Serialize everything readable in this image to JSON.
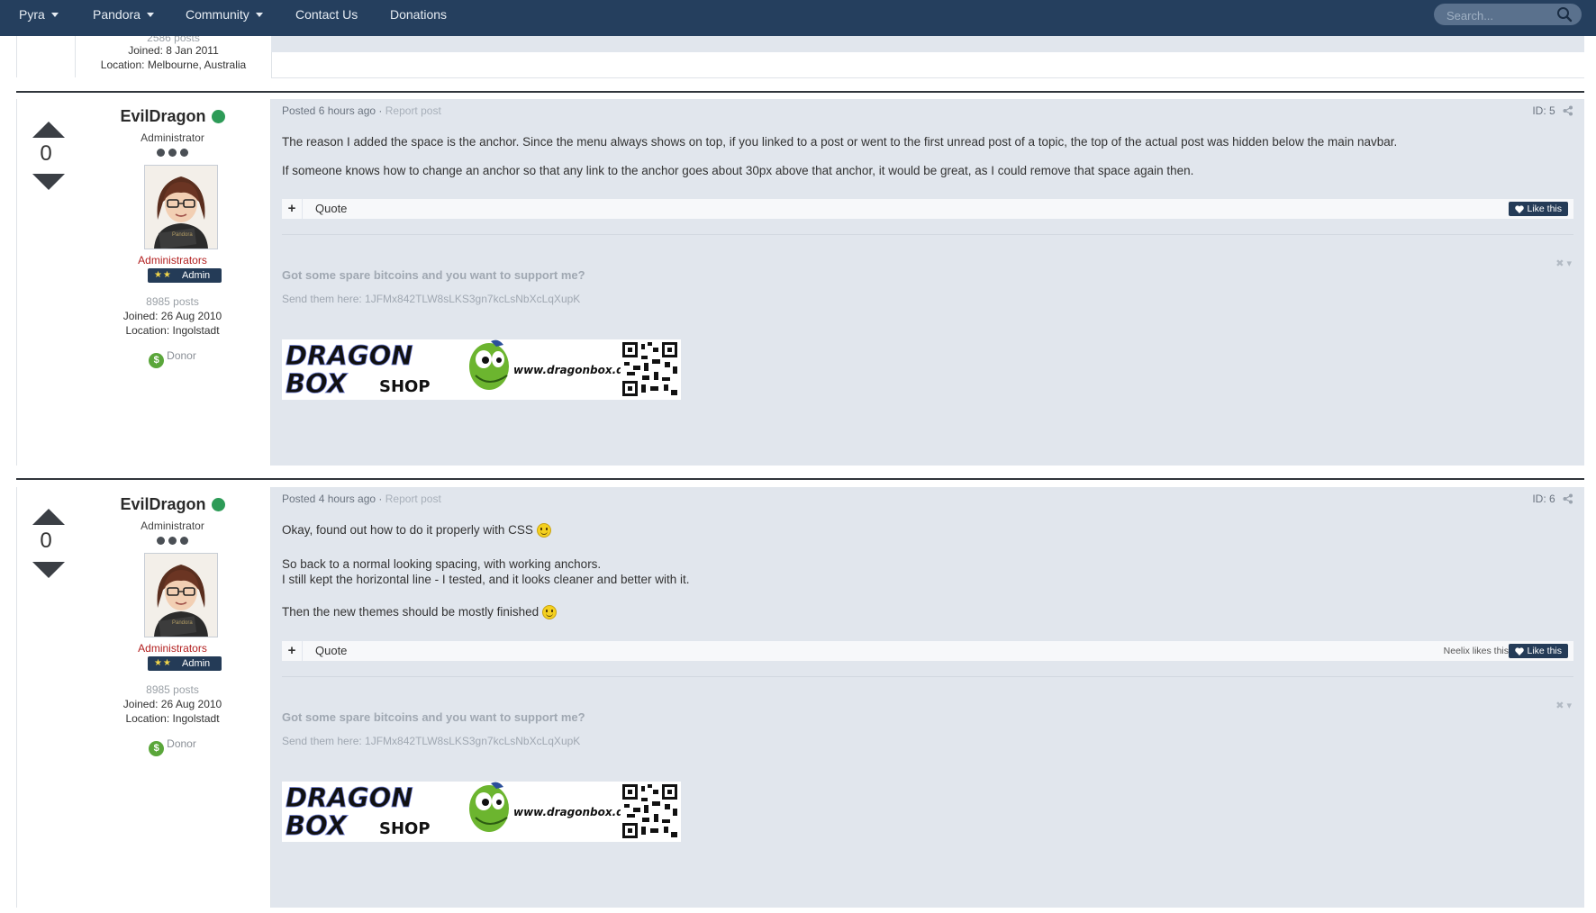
{
  "nav": {
    "items": [
      {
        "label": "Pyra",
        "dropdown": true
      },
      {
        "label": "Pandora",
        "dropdown": true
      },
      {
        "label": "Community",
        "dropdown": true
      },
      {
        "label": "Contact Us",
        "dropdown": false
      },
      {
        "label": "Donations",
        "dropdown": false
      }
    ],
    "search_placeholder": "Search..."
  },
  "previous_post": {
    "posts": "2586 posts",
    "joined": "Joined: 8 Jan 2011",
    "location": "Location: Melbourne, Australia"
  },
  "posts": [
    {
      "votes": "0",
      "author": "EvilDragon",
      "title": "Administrator",
      "group": "Administrators",
      "rank": "Admin",
      "post_count": "8985 posts",
      "joined": "Joined: 26 Aug 2010",
      "location": "Location: Ingolstadt",
      "donor": "Donor",
      "posted": "Posted 6 hours ago",
      "report": "Report post",
      "id": "ID: 5",
      "paragraphs": [
        "The reason I added the space is the anchor. Since the menu always shows on top, if you linked to a post or went to the first unread post of a topic, the top of the actual post was hidden below the main navbar.",
        "If someone knows how to change an anchor so that any link to the anchor goes about 30px above that anchor, it would be great, as I could remove that space again then."
      ],
      "quote_label": "Quote",
      "like_label": "Like this",
      "likers": "",
      "signature_question": "Got some spare bitcoins and you want to support me?",
      "signature_send": "Send them here:  1JFMx842TLW8sLKS3gn7kcLsNbXcLqXupK",
      "banner_line1": "DRAGON",
      "banner_line2": "BOX",
      "banner_shop": "SHOP",
      "banner_url": "www.dragonbox.de"
    },
    {
      "votes": "0",
      "author": "EvilDragon",
      "title": "Administrator",
      "group": "Administrators",
      "rank": "Admin",
      "post_count": "8985 posts",
      "joined": "Joined: 26 Aug 2010",
      "location": "Location: Ingolstadt",
      "donor": "Donor",
      "posted": "Posted 4 hours ago",
      "report": "Report post",
      "id": "ID: 6",
      "paragraphs": [
        "Okay, found out how to do it properly with CSS",
        "So back to a normal looking spacing, with working anchors.",
        "I still kept the horizontal line - I tested, and it looks cleaner and better with it.",
        "Then the new themes should be mostly finished"
      ],
      "quote_label": "Quote",
      "like_label": "Like this",
      "likers": "Neelix likes this",
      "signature_question": "Got some spare bitcoins and you want to support me?",
      "signature_send": "Send them here:  1JFMx842TLW8sLKS3gn7kcLsNbXcLqXupK",
      "banner_line1": "DRAGON",
      "banner_line2": "BOX",
      "banner_shop": "SHOP",
      "banner_url": "www.dragonbox.de"
    }
  ],
  "colors": {
    "navbar": "#253f5e",
    "post_body": "#e1e6ed",
    "group_red": "#b21f1f",
    "online_green": "#2d9b57",
    "donor_green": "#5aa63a"
  },
  "icons": [
    "caret-down-icon",
    "search-icon",
    "vote-up-icon",
    "vote-down-icon",
    "share-icon",
    "plus-icon",
    "heart-icon",
    "close-icon",
    "smiley-icon",
    "dollar-icon"
  ]
}
